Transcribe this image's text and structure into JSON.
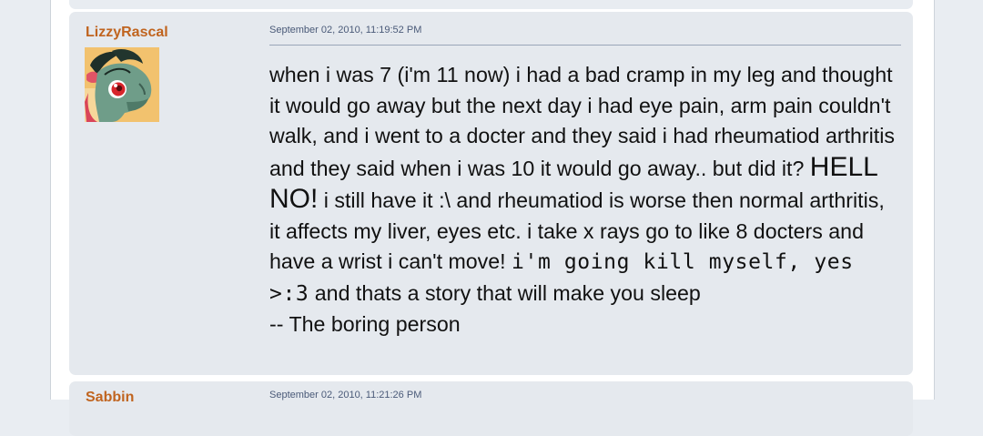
{
  "posts": [
    {
      "username": "LizzyRascal",
      "date": "September 02, 2010, 11:19:52 PM",
      "avatar_alt": "pony avatar",
      "body": {
        "part1": "when i was 7 (i'm 11 now) i had a bad cramp in my leg and thought it would go away but the next day i had eye pain, arm pain couldn't walk, and i went to a docter and they said i had rheumatiod arthritis and they said when i was 10 it would go away.. but did it? ",
        "big": "HELL NO!",
        "part2": " i still have it :\\ and rheumatiod is worse then normal arthritis, it affects my liver, eyes etc. i take x rays go to like 8 docters and have a wrist i can't move! ",
        "mono": "i'm going kill myself, yes >:3",
        "part3": " and thats a story that will make you sleep",
        "signature": "-- The boring person"
      }
    },
    {
      "username": "Sabbin",
      "date": "September 02, 2010, 11:21:26 PM"
    }
  ],
  "colors": {
    "username": "#c0641f",
    "post_bg": "#e5e9ee",
    "date": "#4a5a78",
    "divider": "#9aa6b8"
  }
}
